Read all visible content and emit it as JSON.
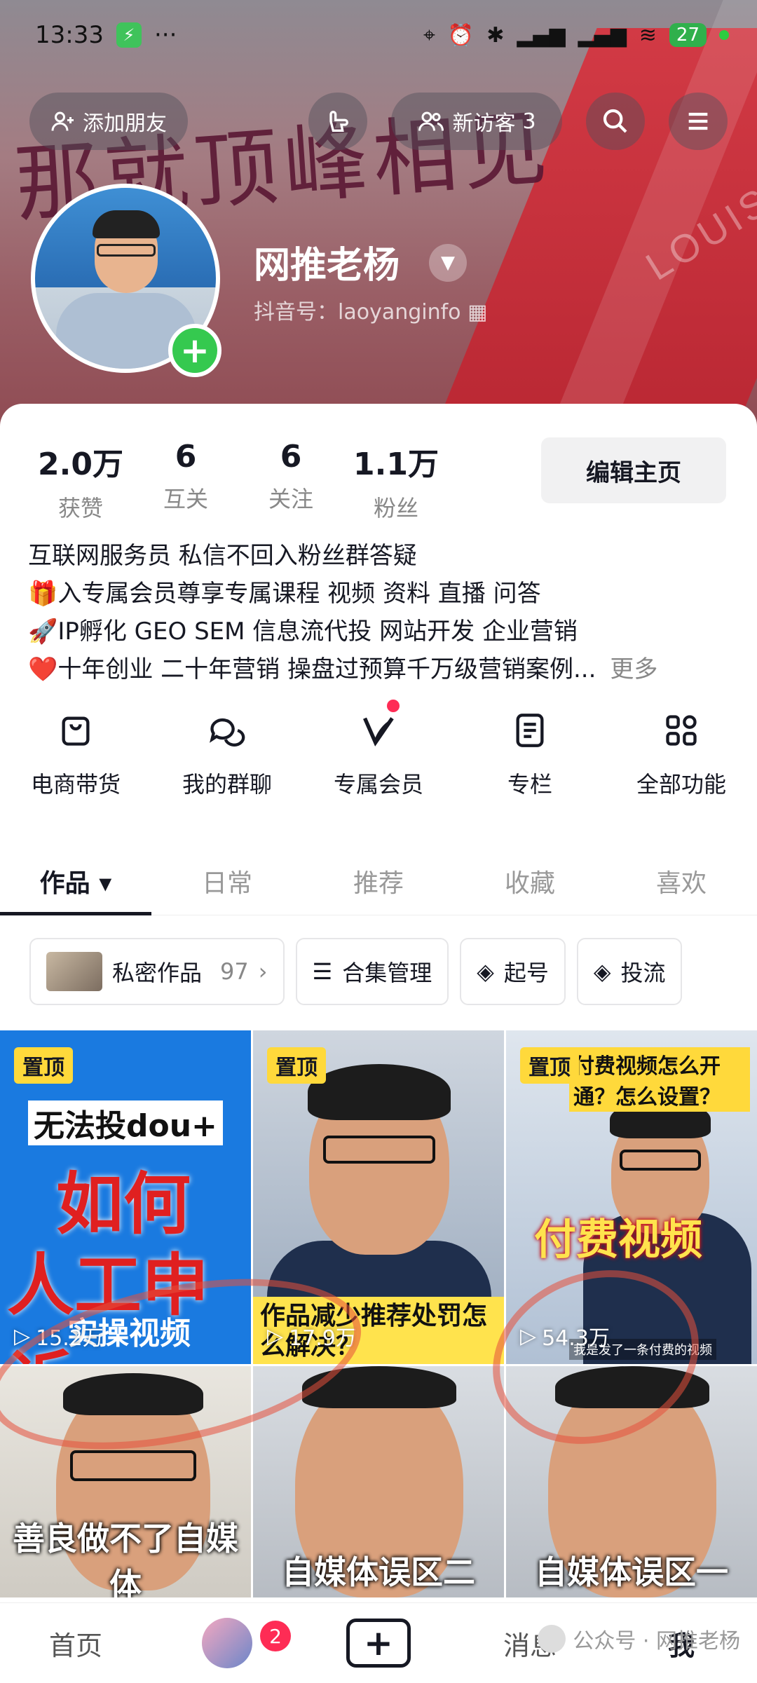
{
  "status_bar": {
    "time": "13:33",
    "more": "···",
    "battery": "27"
  },
  "header": {
    "add_friend": "添加朋友",
    "new_visitors_label": "新访客",
    "new_visitors_count": "3",
    "script_text": "那就顶峰相见",
    "bg_logo_text": "LOUIS"
  },
  "profile": {
    "name": "网推老杨",
    "douyin_id": "抖音号：laoyanginfo"
  },
  "stats": [
    {
      "value": "2.0万",
      "label": "获赞"
    },
    {
      "value": "6",
      "label": "互关"
    },
    {
      "value": "6",
      "label": "关注"
    },
    {
      "value": "1.1万",
      "label": "粉丝"
    }
  ],
  "edit_button": "编辑主页",
  "bio": {
    "line1": "互联网服务员 私信不回入粉丝群答疑",
    "line2": "🎁入专属会员尊享专属课程 视频 资料 直播 问答",
    "line3": "🚀IP孵化 GEO SEM 信息流代投 网站开发 企业营销",
    "line4": "❤️十年创业 二十年营销 操盘过预算千万级营销案例...",
    "more": "更多"
  },
  "features": [
    {
      "label": "电商带货",
      "icon": "bag-icon"
    },
    {
      "label": "我的群聊",
      "icon": "chat-icon"
    },
    {
      "label": "专属会员",
      "icon": "vip-icon"
    },
    {
      "label": "专栏",
      "icon": "document-icon"
    },
    {
      "label": "全部功能",
      "icon": "grid-icon"
    }
  ],
  "tabs": [
    "作品",
    "日常",
    "推荐",
    "收藏",
    "喜欢"
  ],
  "chips": {
    "private": "私密作品",
    "private_count": "97",
    "collection": "合集管理",
    "start": "起号",
    "promote": "投流"
  },
  "videos": [
    {
      "pin": "置顶",
      "plays": "15.2万",
      "lines": [
        "无法投dou+",
        "如何",
        "人工申诉",
        "实操视频"
      ]
    },
    {
      "pin": "置顶",
      "plays": "17.9万",
      "caption": "作品减少推荐处罚怎么解决？"
    },
    {
      "pin": "置顶",
      "plays": "54.3万",
      "top": "付费视频怎么开通？怎么设置？",
      "mid": "付费视频",
      "sub": "我是发了一条付费的视频"
    },
    {
      "caption": "善良做不了自媒体"
    },
    {
      "caption": "自媒体误区二"
    },
    {
      "caption": "自媒体误区一"
    }
  ],
  "bottom_nav": {
    "home": "首页",
    "badge": "2",
    "messages": "消息",
    "me": "我"
  },
  "watermark": "公众号 · 网推老杨"
}
